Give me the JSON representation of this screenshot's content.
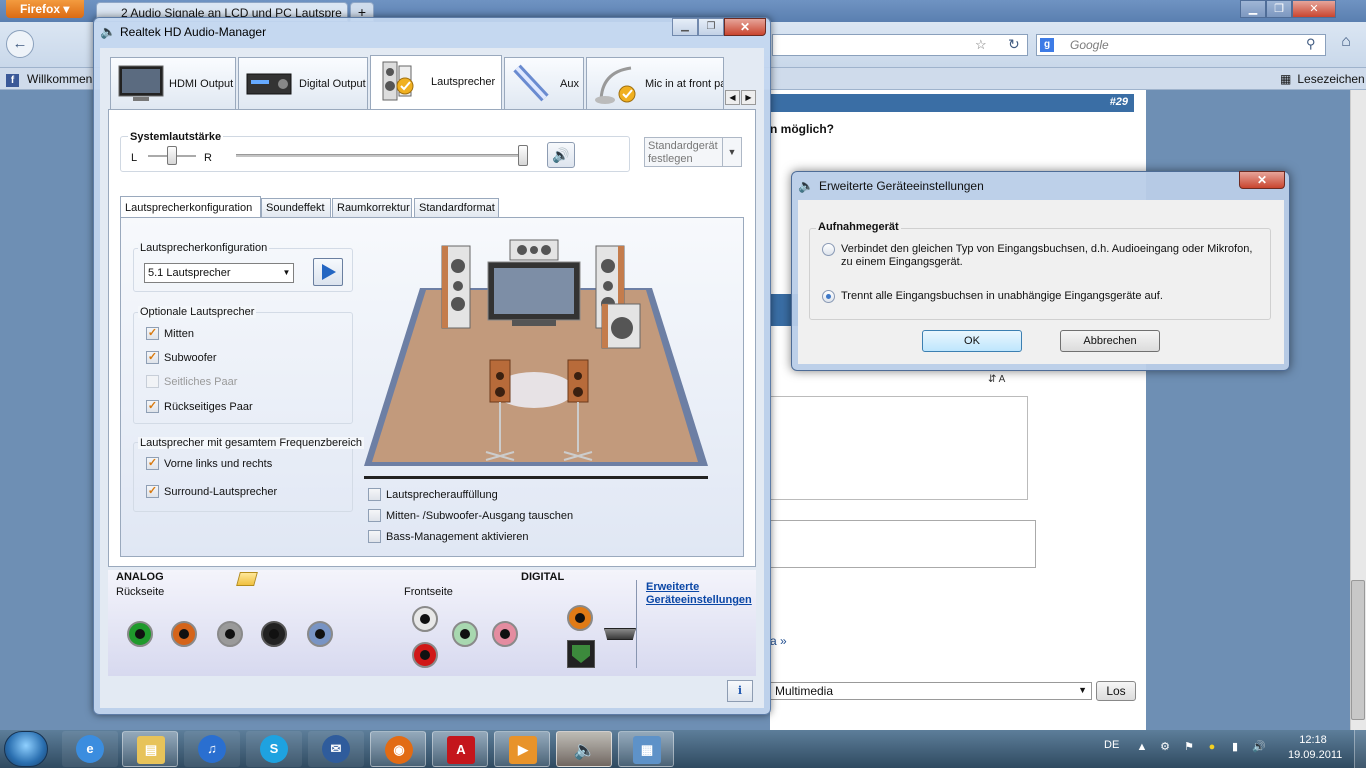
{
  "firefox": {
    "menu_label": "Firefox",
    "tab_title": "2 Audio Signale an LCD und PC Lautspre",
    "new_tab": "+",
    "search_placeholder": "Google",
    "bookmark_left": "Willkommen",
    "bookmark_right": "Lesezeichen"
  },
  "forum": {
    "post_number": "#29",
    "heading_fragment": "n möglich?",
    "link_fragment": "a »",
    "select_value": "Multimedia",
    "los_button": "Los"
  },
  "realtek": {
    "title": "Realtek HD Audio-Manager",
    "device_tabs": [
      {
        "label": "HDMI Output",
        "icon": "monitor-icon"
      },
      {
        "label": "Digital Output",
        "icon": "receiver-icon"
      },
      {
        "label": "Lautsprecher",
        "icon": "speaker-icon"
      },
      {
        "label": "Aux",
        "icon": "aux-icon"
      },
      {
        "label": "Mic in at front pa",
        "icon": "microphone-icon"
      }
    ],
    "system_volume_label": "Systemlautstärke",
    "left_label": "L",
    "right_label": "R",
    "balance_level": 0.5,
    "volume_level": 1.0,
    "default_device_button": "Standardgerät\nfestlegen",
    "sub_tabs": [
      "Lautsprecherkonfiguration",
      "Soundeffekt",
      "Raumkorrektur",
      "Standardformat"
    ],
    "config_group_label": "Lautsprecherkonfiguration",
    "config_selected": "5.1 Lautsprecher",
    "optional_group_label": "Optionale Lautsprecher",
    "optional_items": [
      {
        "label": "Mitten",
        "checked": true,
        "enabled": true
      },
      {
        "label": "Subwoofer",
        "checked": true,
        "enabled": true
      },
      {
        "label": "Seitliches Paar",
        "checked": false,
        "enabled": false
      },
      {
        "label": "Rückseitiges Paar",
        "checked": true,
        "enabled": true
      }
    ],
    "fullrange_group_label": "Lautsprecher mit gesamtem Frequenzbereich",
    "fullrange_items": [
      {
        "label": "Vorne links und rechts",
        "checked": true
      },
      {
        "label": "Surround-Lautsprecher",
        "checked": true
      }
    ],
    "room_options": [
      {
        "label": "Lautsprecherauffüllung",
        "checked": false
      },
      {
        "label": "Mitten- /Subwoofer-Ausgang tauschen",
        "checked": false
      },
      {
        "label": "Bass-Management aktivieren",
        "checked": false
      }
    ],
    "analog_label": "ANALOG",
    "rear_label": "Rückseite",
    "front_label": "Frontseite",
    "digital_label": "DIGITAL",
    "advanced_link": "Erweiterte\nGeräteeinstellungen",
    "info_button": "i",
    "colors": {
      "green_jack": "#1f9a2c",
      "orange_jack": "#d5641a",
      "gray_jack": "#9a9a9a",
      "black_jack": "#222222",
      "blue_jack": "#7894c4",
      "white_jack": "#e8e8e8",
      "red_jack": "#d01818",
      "pink_jack": "#e48ca0",
      "floor": "#c29a7c"
    }
  },
  "dialog": {
    "title": "Erweiterte Geräteeinstellungen",
    "group_label": "Aufnahmegerät",
    "option1": "Verbindet den gleichen Typ von Eingangsbuchsen, d.h. Audioeingang oder Mikrofon,\nzu einem Eingangsgerät.",
    "option2": "Trennt alle Eingangsbuchsen in unabhängige Eingangsgeräte auf.",
    "selected": 2,
    "ok": "OK",
    "cancel": "Abbrechen"
  },
  "taskbar": {
    "items": [
      {
        "name": "internet-explorer-icon",
        "state": "pinned"
      },
      {
        "name": "explorer-icon",
        "state": "running"
      },
      {
        "name": "itunes-icon",
        "state": "pinned"
      },
      {
        "name": "skype-icon",
        "state": "pinned"
      },
      {
        "name": "thunderbird-icon",
        "state": "pinned"
      },
      {
        "name": "firefox-icon",
        "state": "running"
      },
      {
        "name": "acrobat-icon",
        "state": "running"
      },
      {
        "name": "media-player-icon",
        "state": "running"
      },
      {
        "name": "realtek-icon",
        "state": "active"
      },
      {
        "name": "control-panel-icon",
        "state": "running"
      }
    ],
    "language": "DE",
    "time": "12:18",
    "date": "19.09.2011"
  }
}
